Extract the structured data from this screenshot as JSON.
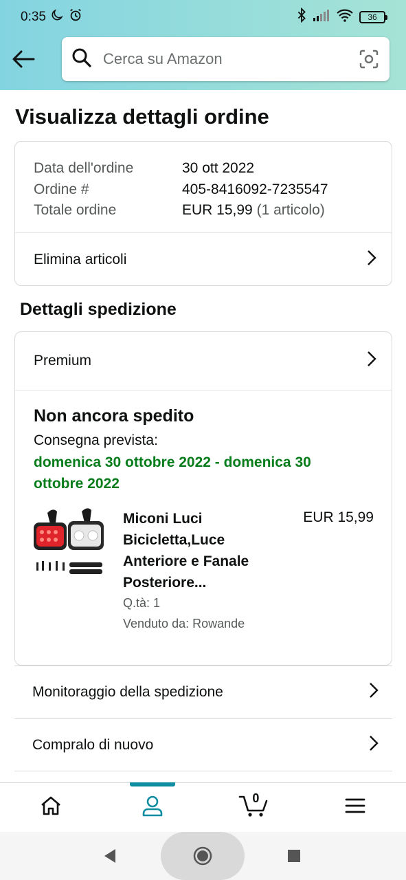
{
  "status_bar": {
    "time": "0:35",
    "battery": "36"
  },
  "search": {
    "placeholder": "Cerca su Amazon"
  },
  "page_title": "Visualizza dettagli ordine",
  "order": {
    "rows": [
      {
        "label": "Data dell'ordine",
        "value": "30 ott 2022",
        "extra": ""
      },
      {
        "label": "Ordine #",
        "value": "405-8416092-7235547",
        "extra": ""
      },
      {
        "label": "Totale ordine",
        "value": "EUR 15,99",
        "extra": "(1 articolo)"
      }
    ],
    "delete_items_label": "Elimina articoli"
  },
  "shipping": {
    "section_title": "Dettagli spedizione",
    "method": "Premium",
    "status": "Non ancora spedito",
    "delivery_label": "Consegna prevista:",
    "delivery_date": "domenica 30 ottobre 2022 - domenica 30 ottobre 2022",
    "product": {
      "title": "Miconi Luci Bicicletta,Luce Anteriore e Fanale Posteriore...",
      "price": "EUR 15,99",
      "quantity": "Q.tà: 1",
      "seller": "Venduto da: Rowande"
    }
  },
  "links": {
    "track": "Monitoraggio della spedizione",
    "buy_again": "Compralo di nuovo"
  },
  "bottom_nav": {
    "cart_count": "0",
    "active_tab": "account",
    "accent_color": "#0f8ea3"
  },
  "colors": {
    "delivery_green": "#067d1a",
    "header_gradient_start": "#83d4e1",
    "header_gradient_end": "#a5e3d6"
  }
}
